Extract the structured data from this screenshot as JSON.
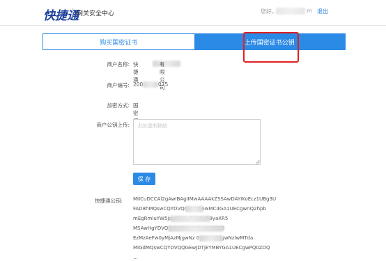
{
  "header": {
    "logo": "快捷通",
    "subtitle": "网关安全中心",
    "greeting": "您好，",
    "user_suffix": "m",
    "logout": "退出"
  },
  "tabs": [
    {
      "label": "购买国密证书",
      "active": false
    },
    {
      "label": "上传国密证书公钥",
      "active": true
    }
  ],
  "form": {
    "merchant_name_label": "商户名称:",
    "merchant_name_prefix": "快捷通",
    "merchant_name_suffix": "有限公司",
    "merchant_no_label": "商户编号:",
    "merchant_no_prefix": "200",
    "merchant_no_suffix": "075",
    "encrypt_label": "加密方式:",
    "encrypt_value": "国密证书",
    "upload_label": "商户公钥上传:",
    "upload_placeholder": "此处复制粘贴",
    "save_label": "保 存",
    "kjt_key_label": "快捷通公钥:",
    "kjt_key_lines": [
      "MIICuDCCAl2gAwIBAgIIMwAAAAkZSSAwDAYIKoEcz1UBg3U",
      "FAD8hMQswCQYDVQQG          DTjEwMC4GA1UECgwnQ2hpb",
      "mEgRmluYW5ja            pb24gQXV0aG9yaXR5",
      "MSAwHgYDVQQ                 BURVNUIFNNMiBPQ0",
      "EzMzAeFw0yMjAzMjgwNz          0yNDAzMjgwNzIwMTda",
      "MIGdMQswCQYDVQQGEwJDTjEYMBYGA1UECgwPQ0ZDQ",
      "..."
    ]
  },
  "colors": {
    "primary": "#2b8ae6",
    "logo": "#1a3f9c",
    "highlight": "#e02020"
  }
}
